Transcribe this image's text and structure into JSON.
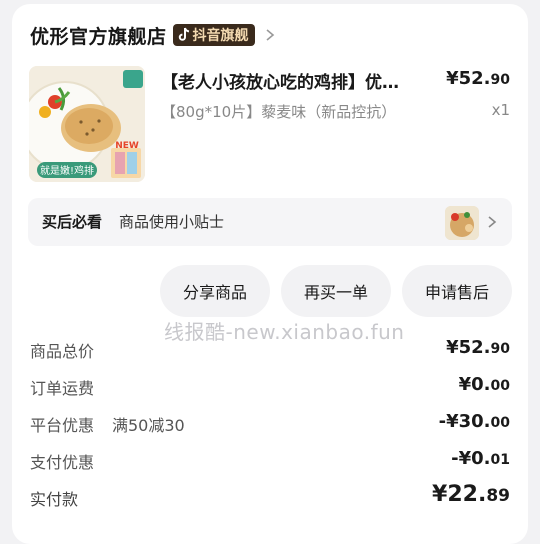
{
  "store": {
    "name": "优形官方旗舰店",
    "badge": "抖音旗舰"
  },
  "product": {
    "title": "【老人小孩放心吃的鸡排】优…",
    "price_main": "¥52.",
    "price_cents": "90",
    "spec": "【80g*10片】藜麦味（新品控抗）",
    "quantity": "x1",
    "image_caption": "就是嫩!鸡排",
    "image_new_tag": "NEW"
  },
  "tips": {
    "title": "买后必看",
    "description": "商品使用小贴士"
  },
  "actions": {
    "share": "分享商品",
    "rebuy": "再买一单",
    "after_sale": "申请售后"
  },
  "watermark": "线报酷-new.xianbao.fun",
  "summary": {
    "goods_total": {
      "label": "商品总价",
      "main": "¥52.",
      "cents": "90"
    },
    "shipping": {
      "label": "订单运费",
      "main": "¥0.",
      "cents": "00"
    },
    "platform_discount": {
      "label": "平台优惠",
      "extra": "满50减30",
      "main": "-¥30.",
      "cents": "00"
    },
    "payment_discount": {
      "label": "支付优惠",
      "main": "-¥0.",
      "cents": "01"
    },
    "paid": {
      "label": "实付款",
      "main": "¥22.",
      "cents": "89"
    }
  },
  "colors": {
    "badge_bg": "#3a2a1c",
    "badge_text": "#f3d9b0",
    "card_bg": "#ffffff",
    "page_bg": "#f2f2f4"
  },
  "icons": {
    "tiktok": "tiktok-logo-icon",
    "chevron": "chevron-right-icon"
  }
}
